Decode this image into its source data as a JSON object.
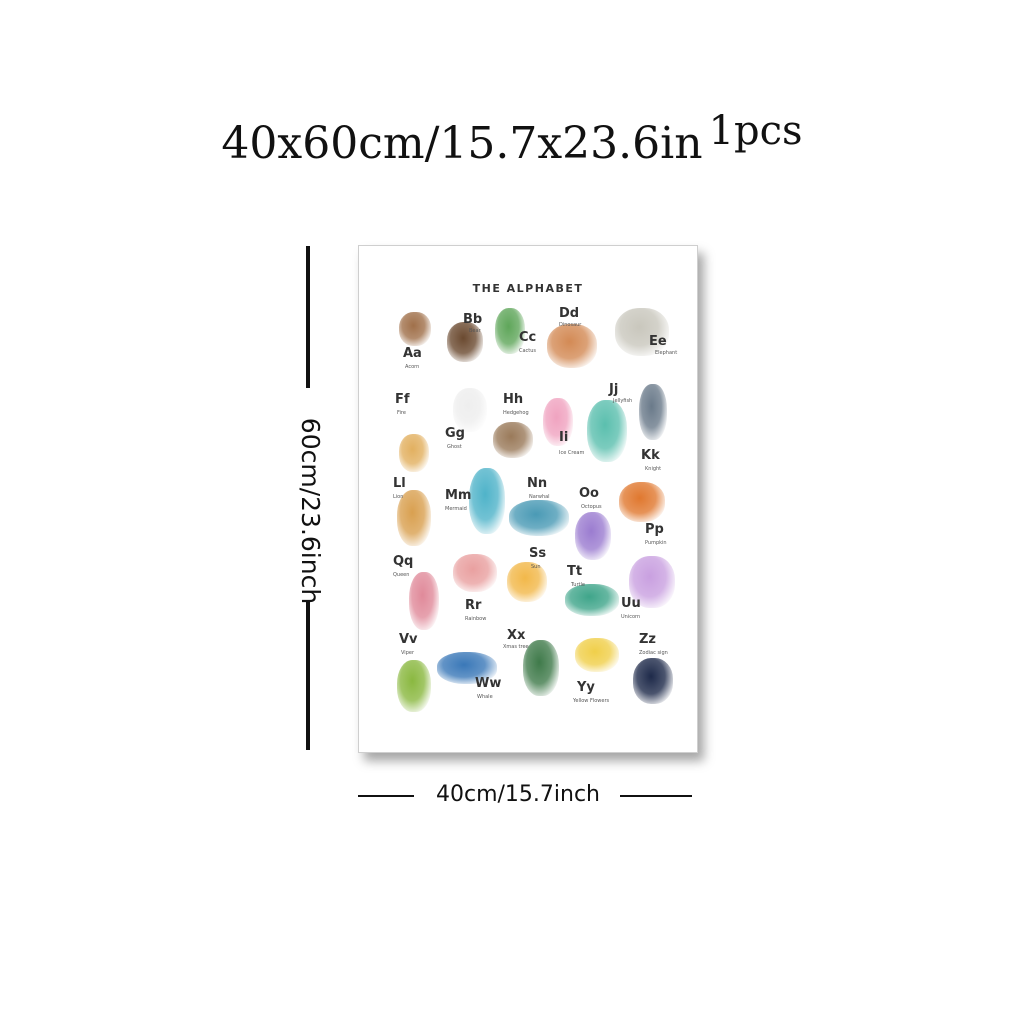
{
  "headline": {
    "size": "40x60cm/15.7x23.6in",
    "qty": "1pcs"
  },
  "dimensions": {
    "height_label": "60cm/23.6inch",
    "width_label": "40cm/15.7inch"
  },
  "poster": {
    "title": "THE ALPHABET",
    "entries": [
      {
        "letter": "Aa",
        "word": "Acorn",
        "color": "#a0704a"
      },
      {
        "letter": "Bb",
        "word": "Bear",
        "color": "#6b4a30"
      },
      {
        "letter": "Cc",
        "word": "Cactus",
        "color": "#5fa65a"
      },
      {
        "letter": "Dd",
        "word": "Dinosaur",
        "color": "#d38a55"
      },
      {
        "letter": "Ee",
        "word": "Elephant",
        "color": "#c9c7bd"
      },
      {
        "letter": "Ff",
        "word": "Fire",
        "color": "#e2b060"
      },
      {
        "letter": "Gg",
        "word": "Ghost",
        "color": "#eeeeee"
      },
      {
        "letter": "Hh",
        "word": "Hedgehog",
        "color": "#9a7a5a"
      },
      {
        "letter": "Ii",
        "word": "Ice Cream",
        "color": "#f0a3c0"
      },
      {
        "letter": "Jj",
        "word": "Jellyfish",
        "color": "#5bbfae"
      },
      {
        "letter": "Kk",
        "word": "Knight",
        "color": "#6a7a8a"
      },
      {
        "letter": "Ll",
        "word": "Lion",
        "color": "#d9a050"
      },
      {
        "letter": "Mm",
        "word": "Mermaid",
        "color": "#4fb3c9"
      },
      {
        "letter": "Nn",
        "word": "Narwhal",
        "color": "#4a9ab5"
      },
      {
        "letter": "Oo",
        "word": "Octopus",
        "color": "#9b7cd0"
      },
      {
        "letter": "Pp",
        "word": "Pumpkin",
        "color": "#e0782f"
      },
      {
        "letter": "Qq",
        "word": "Queen",
        "color": "#e08a9a"
      },
      {
        "letter": "Rr",
        "word": "Rainbow",
        "color": "#e9a0a0"
      },
      {
        "letter": "Ss",
        "word": "Sun",
        "color": "#f2b84a"
      },
      {
        "letter": "Tt",
        "word": "Turtle",
        "color": "#3fa58a"
      },
      {
        "letter": "Uu",
        "word": "Unicorn",
        "color": "#c9a0e0"
      },
      {
        "letter": "Vv",
        "word": "Viper",
        "color": "#8ab840"
      },
      {
        "letter": "Ww",
        "word": "Whale",
        "color": "#3a78b8"
      },
      {
        "letter": "Xx",
        "word": "Xmas tree",
        "color": "#3f7a4a"
      },
      {
        "letter": "Yy",
        "word": "Yellow Flowers",
        "color": "#f0cf4a"
      },
      {
        "letter": "Zz",
        "word": "Zodiac sign",
        "color": "#1e2a4a"
      }
    ]
  }
}
